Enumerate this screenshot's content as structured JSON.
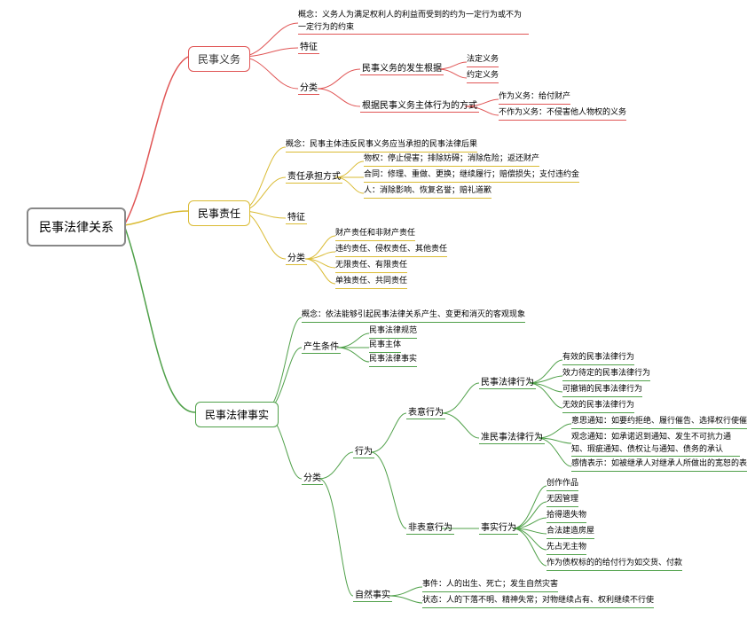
{
  "root": "民事法律关系",
  "b1": {
    "obligation": "民事义务",
    "liability": "民事责任",
    "facts": "民事法律事实"
  },
  "red": {
    "concept": "概念：义务人为满足权利人的利益而受到的约为一定行为或不为一定行为的约束",
    "features": "特征",
    "classify": "分类",
    "basis": "民事义务的发生根据",
    "basisChildA": "法定义务",
    "basisChildB": "约定义务",
    "byMethod": "根据民事义务主体行为的方式",
    "methodA": "作为义务：给付财产",
    "methodB": "不作为义务：不侵害他人物权的义务"
  },
  "yel": {
    "concept": "概念：民事主体违反民事义务应当承担的民事法律后果",
    "mode": "责任承担方式",
    "modeA": "物权：停止侵害；排除妨碍；消除危险；返还财产",
    "modeB": "合同：修理、重做、更换；继续履行；赔偿损失；支付违约金",
    "modeC": "人：消除影响、恢复名誉；赔礼道歉",
    "features": "特征",
    "classify": "分类",
    "classA": "财产责任和非财产责任",
    "classB": "违约责任、侵权责任、其他责任",
    "classC": "无限责任、有限责任",
    "classD": "单独责任、共同责任"
  },
  "grn": {
    "concept": "概念：依法能够引起民事法律关系产生、变更和消灭的客观现象",
    "cond": "产生条件",
    "condA": "民事法律规范",
    "condB": "民事主体",
    "condC": "民事法律事实",
    "classify": "分类",
    "act": "行为",
    "natural": "自然事实",
    "will": "表意行为",
    "nonwill": "非表意行为",
    "civilAct": "民事法律行为",
    "civilA": "有效的民事法律行为",
    "civilB": "效力待定的民事法律行为",
    "civilC": "可撤销的民事法律行为",
    "civilD": "无效的民事法律行为",
    "quasi": "准民事法律行为",
    "quasiA": "意思通知：如要约拒绝、履行催告、选择权行使催告",
    "quasiB": "观念通知：如承诺迟到通知、发生不可抗力通知、瑕疵通知、债权让与通知、债务的承认",
    "quasiC": "感情表示：如被继承人对继承人所做出的宽恕的表示",
    "factual": "事实行为",
    "factA": "创作作品",
    "factB": "无因管理",
    "factC": "拾得遗失物",
    "factD": "合法建造房屋",
    "factE": "先占无主物",
    "factF": "作为债权标的的给付行为如交货、付款",
    "event": "事件：人的出生、死亡；发生自然灾害",
    "state": "状态：人的下落不明、精神失常；对物继续占有、权利继续不行使"
  }
}
